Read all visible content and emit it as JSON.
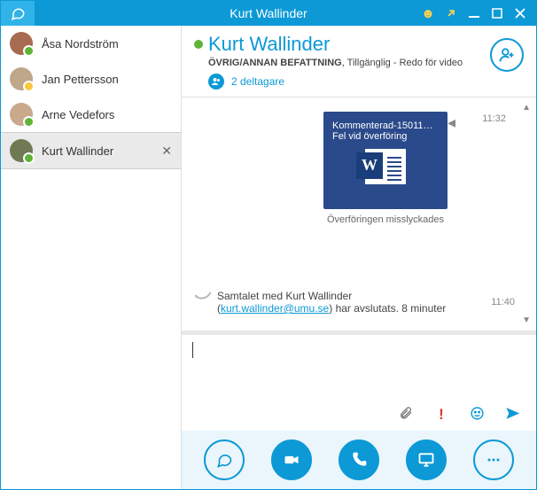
{
  "colors": {
    "accent": "#0c99d6",
    "available": "#5fb336",
    "away": "#f8c73e",
    "wordTile": "#2b4a8b"
  },
  "titlebar": {
    "title": "Kurt Wallinder"
  },
  "sidebar": {
    "contacts": [
      {
        "name": "Åsa Nordström",
        "presence": "available",
        "avatarColor": "#a86b52"
      },
      {
        "name": "Jan Pettersson",
        "presence": "away",
        "avatarColor": "#bfa78a"
      },
      {
        "name": "Arne Vedefors",
        "presence": "available",
        "avatarColor": "#c9a88c"
      },
      {
        "name": "Kurt Wallinder",
        "presence": "available",
        "selected": true,
        "avatarColor": "#6f7a55"
      }
    ]
  },
  "header": {
    "contactName": "Kurt Wallinder",
    "roleLabel": "ÖVRIG/ANNAN BEFATTNING",
    "statusSeparator": ", ",
    "statusText": "Tillgänglig - Redo för video",
    "participantsLabel": "2 deltagare"
  },
  "file": {
    "title": "Kommenterad-15011…",
    "error": "Fel vid överföring",
    "caption": "Överföringen misslyckades",
    "time": "11:32"
  },
  "call": {
    "prefix": "Samtalet med ",
    "contactName": "Kurt Wallinder",
    "open": " (",
    "email": "kurt.wallinder@umu.se",
    "suffix": ") har avslutats. 8 minuter",
    "time": "11:40"
  },
  "compose": {
    "placeholder": ""
  }
}
